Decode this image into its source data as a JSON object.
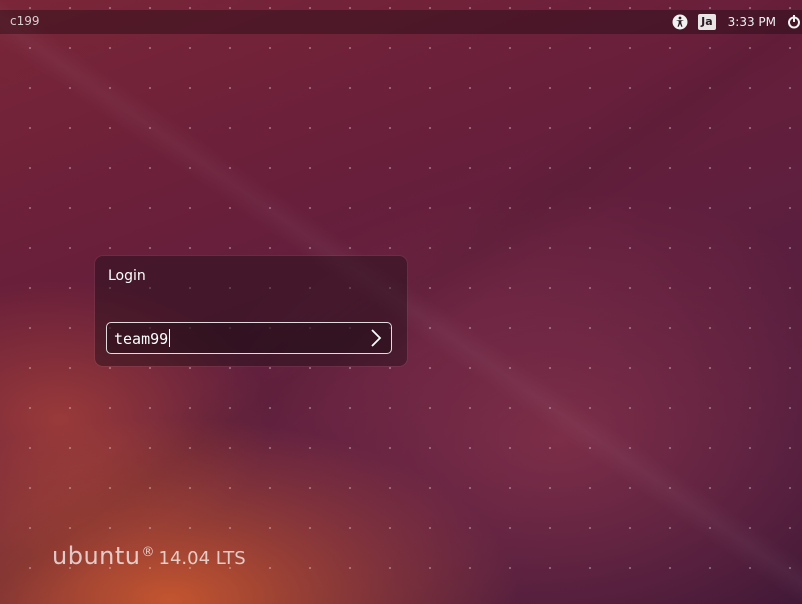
{
  "top_panel": {
    "hostname": "c199",
    "keyboard_layout": "Ja",
    "clock": "3:33 PM",
    "icons": [
      "accessibility-icon",
      "power-icon"
    ]
  },
  "login": {
    "title": "Login",
    "username_value": "team99",
    "submit_icon": "chevron-right-icon"
  },
  "branding": {
    "name": "ubuntu",
    "mark": "®",
    "version": "14.04 LTS"
  },
  "colors": {
    "background_top": "#6a1f3a",
    "background_glow": "#d75f2d",
    "panel_text": "#f2f2f2"
  }
}
